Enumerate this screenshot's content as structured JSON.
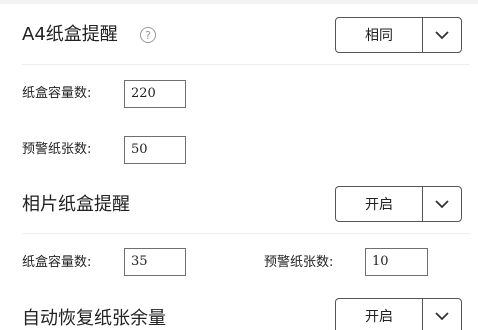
{
  "sections": [
    {
      "title": "A4纸盒提醒",
      "select_value": "相同",
      "fields": [
        {
          "label": "纸盒容量数:",
          "value": "220"
        },
        {
          "label": "预警纸张数:",
          "value": "50"
        }
      ]
    },
    {
      "title": "相片纸盒提醒",
      "select_value": "开启",
      "fields": [
        {
          "label": "纸盒容量数:",
          "value": "35"
        },
        {
          "label": "预警纸张数:",
          "value": "10"
        }
      ]
    },
    {
      "title": "自动恢复纸张余量",
      "select_value": "开启"
    }
  ],
  "icons": {
    "help": "question-circle-icon",
    "dropdown": "chevron-down-icon"
  },
  "help_glyph": "?",
  "colors": {
    "border": "#555555",
    "text": "#222222",
    "separator": "#eeeeee"
  }
}
